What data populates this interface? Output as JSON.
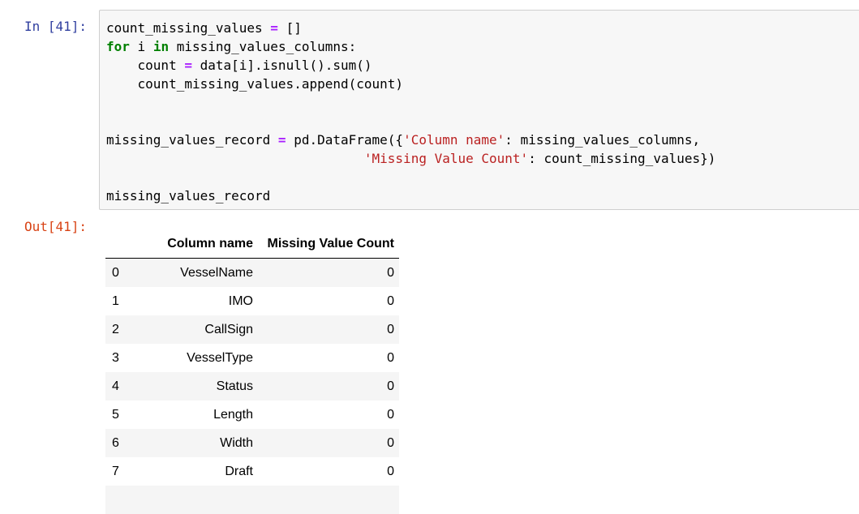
{
  "input_prompt": "In [41]:",
  "output_prompt": "Out[41]:",
  "code": {
    "l1_a": "count_missing_values ",
    "l1_op": "=",
    "l1_b": " []",
    "l2_for": "for",
    "l2_a": " i ",
    "l2_in": "in",
    "l2_b": " missing_values_columns:",
    "l3_a": "    count ",
    "l3_op": "=",
    "l3_b": " data[i].isnull().sum()",
    "l4": "    count_missing_values.append(count)",
    "l7_a": "missing_values_record ",
    "l7_op": "=",
    "l7_b": " pd.DataFrame({",
    "l7_str": "'Column name'",
    "l7_c": ": missing_values_columns,",
    "l8_pad": "                                 ",
    "l8_str": "'Missing Value Count'",
    "l8_c": ": count_missing_values})",
    "l10": "missing_values_record"
  },
  "table": {
    "headers": [
      "",
      "Column name",
      "Missing Value Count"
    ],
    "rows": [
      {
        "index": "0",
        "column": "VesselName",
        "count": "0"
      },
      {
        "index": "1",
        "column": "IMO",
        "count": "0"
      },
      {
        "index": "2",
        "column": "CallSign",
        "count": "0"
      },
      {
        "index": "3",
        "column": "VesselType",
        "count": "0"
      },
      {
        "index": "4",
        "column": "Status",
        "count": "0"
      },
      {
        "index": "5",
        "column": "Length",
        "count": "0"
      },
      {
        "index": "6",
        "column": "Width",
        "count": "0"
      },
      {
        "index": "7",
        "column": "Draft",
        "count": "0"
      }
    ]
  }
}
